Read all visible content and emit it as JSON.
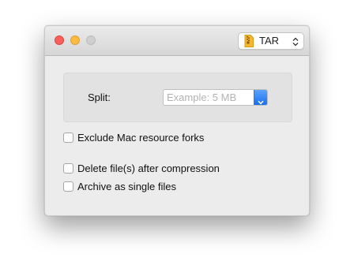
{
  "toolbar": {
    "format_label": "TAR",
    "archive_icon": "archive-zip-icon",
    "updown_icon": "up-down-chevron-icon"
  },
  "split": {
    "label": "Split:",
    "value": "",
    "placeholder": "Example: 5 MB",
    "dropdown_icon": "chevron-down-icon"
  },
  "options": {
    "exclude_resource_forks": {
      "label": "Exclude Mac resource forks",
      "checked": false
    },
    "delete_after_compression": {
      "label": "Delete file(s) after compression",
      "checked": false
    },
    "archive_single_files": {
      "label": "Archive as single files",
      "checked": false
    }
  },
  "colors": {
    "accent": "#1a6ff0",
    "close": "#fc605c",
    "minimize": "#fdbc40",
    "zoom_disabled": "#cfcfcf",
    "archive_icon": "#f5b731"
  }
}
